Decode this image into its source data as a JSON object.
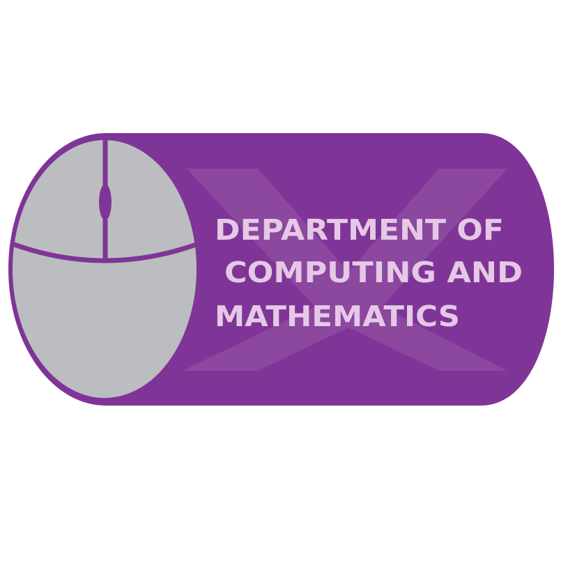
{
  "logo": {
    "lines": [
      "DEPARTMENT OF",
      "COMPUTING AND",
      "MATHEMATICS"
    ],
    "icon": "computer-mouse-icon",
    "watermark": "x-mark"
  },
  "colors": {
    "primary": "#7f3597",
    "watermark": "#8c479f",
    "mouse": "#bcbdc0",
    "text": "#e5c8e6",
    "background": "#ffffff"
  }
}
